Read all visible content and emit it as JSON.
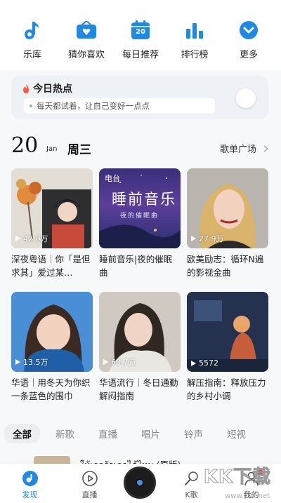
{
  "quick_nav": [
    {
      "label": "乐库",
      "icon": "music-note-icon"
    },
    {
      "label": "猜你喜欢",
      "icon": "radio-heart-icon"
    },
    {
      "label": "每日推荐",
      "icon": "calendar-icon",
      "icon_text": "20"
    },
    {
      "label": "排行榜",
      "icon": "bar-chart-icon"
    },
    {
      "label": "更多",
      "icon": "chevron-down-circle-icon"
    }
  ],
  "hot_topics": {
    "title": "今日热点",
    "subtitle": "每天都试着，让自己变好一点点"
  },
  "date": {
    "day": "20",
    "month": "Jan",
    "weekday": "周三"
  },
  "playlist_plaza_link": "歌单广场",
  "playlists": [
    {
      "title": "深夜粤语｜你「是但求其」爱过某…",
      "plays": "42.0万",
      "cover": "cover-autumn-girl"
    },
    {
      "title": "睡前音乐|夜的催眠曲",
      "plays": "",
      "tag": "电台",
      "cover_text": "睡前音乐",
      "cover_sub": "夜的催眠曲"
    },
    {
      "title": "欧美励志：循环N遍的影视金曲",
      "plays": "27.9万",
      "cover": "cover-singer-portrait"
    },
    {
      "title": "华语｜用冬天为你织一条蓝色的围巾",
      "plays": "13.5万",
      "cover": "cover-blue-scarf"
    },
    {
      "title": "华语流行｜冬日通勤解闷指南",
      "plays": "60.7万",
      "cover": "cover-winter-girl"
    },
    {
      "title": "解压指南：释放压力的乡村小调",
      "plays": "5572",
      "cover": "cover-night-room"
    }
  ],
  "category_tabs": [
    "全部",
    "新歌",
    "直播",
    "唱片",
    "铃声",
    "短视"
  ],
  "now_playing_title": "ให้เธอรักเธอได้ไหม (原版)",
  "bottom_nav": [
    {
      "label": "发现",
      "icon": "discover-icon",
      "active": true
    },
    {
      "label": "直播",
      "icon": "play-circle-icon"
    },
    {
      "label": "K歌",
      "icon": "microphone-icon"
    },
    {
      "label": "我的",
      "icon": "user-icon"
    }
  ],
  "watermark": {
    "brand": "KK下载",
    "url": "www.kkx.net"
  },
  "colors": {
    "accent": "#1e88e5",
    "hot": "#ff5a3c"
  }
}
